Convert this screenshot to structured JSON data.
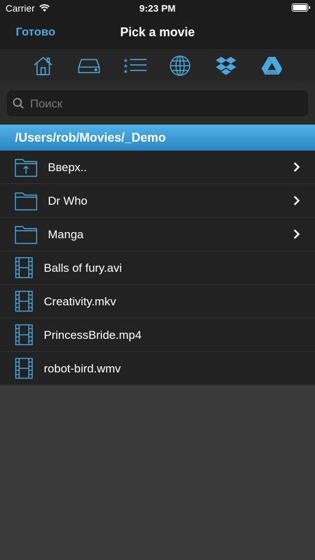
{
  "status_bar": {
    "carrier": "Carrier",
    "time": "9:23 PM"
  },
  "nav": {
    "done_label": "Готово",
    "title": "Pick a movie"
  },
  "toolbar": {
    "icons": [
      "home-icon",
      "drive-icon",
      "favorites-list-icon",
      "globe-icon",
      "dropbox-icon",
      "google-drive-icon"
    ]
  },
  "search": {
    "placeholder": "Поиск",
    "value": ""
  },
  "path": "/Users/rob/Movies/_Demo",
  "folders": [
    {
      "label": "Вверх..",
      "icon": "folder-up-icon"
    },
    {
      "label": "Dr Who",
      "icon": "folder-icon"
    },
    {
      "label": "Manga",
      "icon": "folder-icon"
    }
  ],
  "files": [
    {
      "label": "Balls of fury.avi",
      "icon": "film-icon"
    },
    {
      "label": "Creativity.mkv",
      "icon": "film-icon"
    },
    {
      "label": "PrincessBride.mp4",
      "icon": "film-icon"
    },
    {
      "label": "robot-bird.wmv",
      "icon": "film-icon"
    }
  ],
  "colors": {
    "accent": "#4aa8e0",
    "path_bar": "#3a9ed6",
    "row_bg": "#222222",
    "background": "#3a3a3a"
  }
}
